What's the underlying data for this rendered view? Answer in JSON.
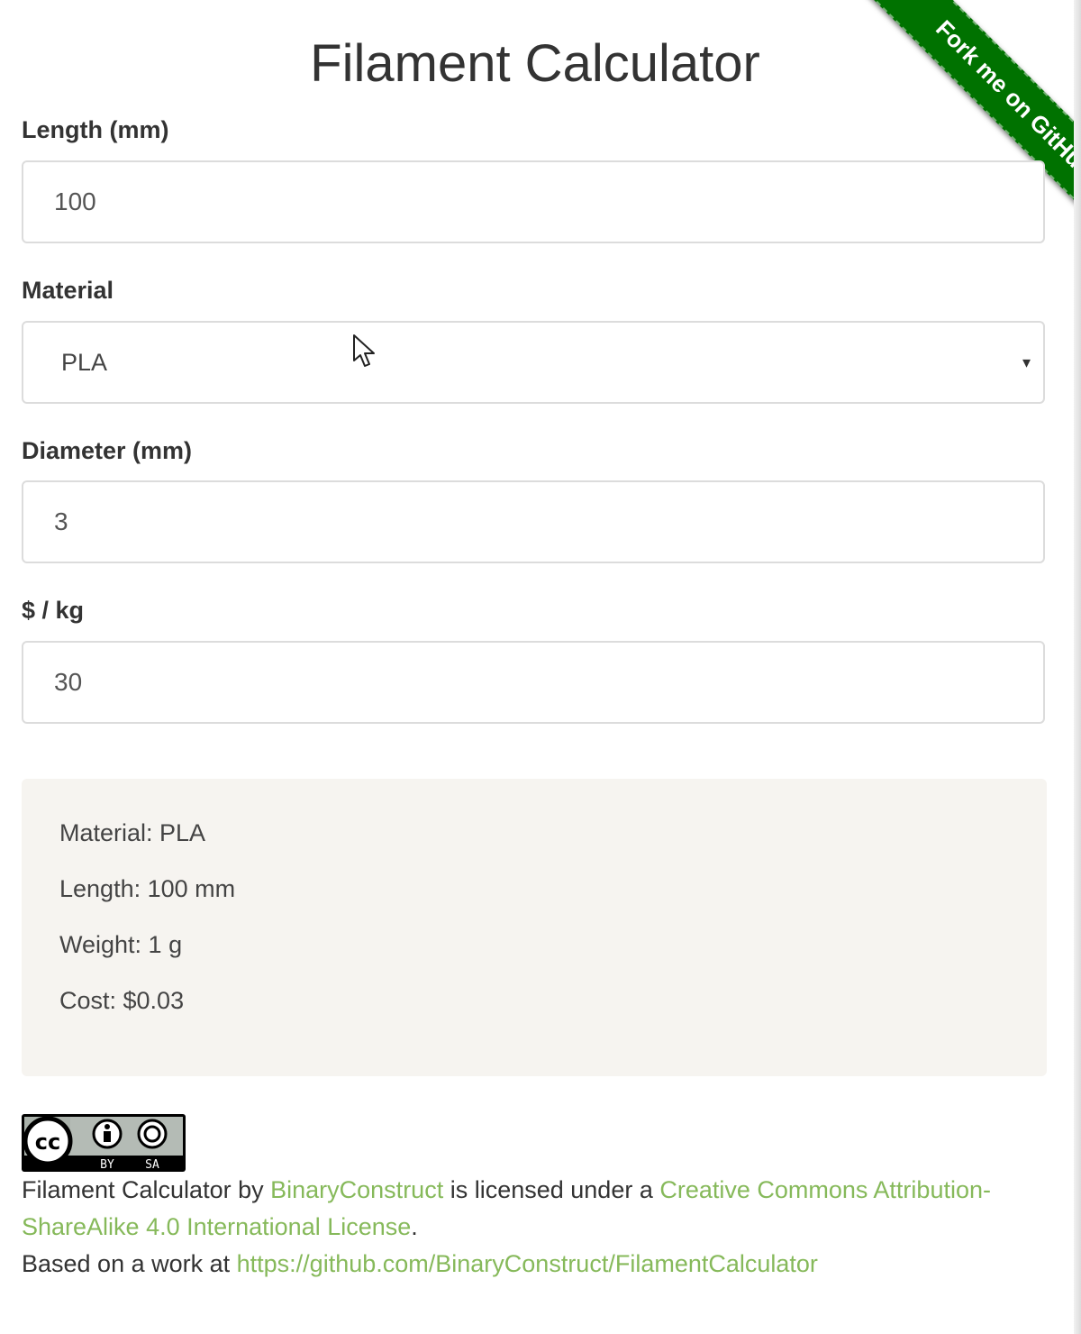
{
  "page": {
    "title": "Filament Calculator"
  },
  "form": {
    "length": {
      "label": "Length (mm)",
      "value": "100"
    },
    "material": {
      "label": "Material",
      "selected": "PLA",
      "arrow": "▾"
    },
    "diameter": {
      "label": "Diameter (mm)",
      "value": "3"
    },
    "price": {
      "label": "$ / kg",
      "value": "30"
    }
  },
  "results": {
    "material": "Material: PLA",
    "length": "Length: 100 mm",
    "weight": "Weight: 1 g",
    "cost": "Cost: $0.03"
  },
  "ribbon": {
    "label": "Fork me on GitHub",
    "color": "#007200"
  },
  "license": {
    "badge_icon": "cc-by-sa-badge",
    "badge_by": "BY",
    "badge_sa": "SA",
    "work_title": "Filament Calculator",
    "by_text": " by ",
    "author_link": "BinaryConstruct",
    "licensed_text": " is licensed under a ",
    "license_link": "Creative Commons Attribution-ShareAlike 4.0 International License",
    "period": ".",
    "based_on_text": "Based on a work at ",
    "source_link": "https://github.com/BinaryConstruct/FilamentCalculator"
  },
  "colors": {
    "link": "#86b95a",
    "panel_bg": "#f6f4f0",
    "ribbon": "#007200"
  }
}
